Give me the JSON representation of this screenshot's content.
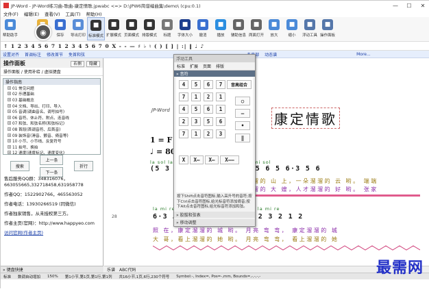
{
  "window": {
    "title": "JP-Word - JP-Word练习曲-歌曲-康定情歌.jpwabc <=> D:\\JPW6简谱编曲集\\demo\\ (cpu:0.1)",
    "controls": [
      "—",
      "☐",
      "✕"
    ]
  },
  "menu": [
    "文件(F)",
    "编辑(E)",
    "查看(V)",
    "工具(T)",
    "帮助(H)"
  ],
  "ribbon": [
    {
      "label": "帮助助手",
      "icon": "help-icon",
      "color": "#4b8ad8"
    },
    {
      "label": "打开",
      "icon": "open-folder-icon",
      "color": "#e9b23a"
    },
    {
      "label": "保存",
      "icon": "save-icon",
      "color": "#3a6fd0"
    },
    {
      "label": "导出打印",
      "icon": "export-print-icon",
      "color": "#5a8ed8"
    },
    {
      "label": "标准模式",
      "icon": "standard-mode-icon",
      "color": "#333333"
    },
    {
      "label": "扩展模式",
      "icon": "extended-mode-icon",
      "color": "#333333"
    },
    {
      "label": "页面模式",
      "icon": "page-mode-icon",
      "color": "#333333"
    },
    {
      "label": "排版模式",
      "icon": "layout-mode-icon",
      "color": "#333333"
    },
    {
      "label": "标题",
      "icon": "title-icon",
      "color": "#777777"
    },
    {
      "label": "字体大小",
      "icon": "font-size-icon",
      "color": "#1c3d8e"
    },
    {
      "label": "撤消",
      "icon": "undo-icon",
      "color": "#3a6fd0"
    },
    {
      "label": "播放",
      "icon": "play-icon",
      "color": "#2b8ee0"
    },
    {
      "label": "辅助信息",
      "icon": "assist-info-icon",
      "color": "#666666"
    },
    {
      "label": "两面打开",
      "icon": "two-page-icon",
      "color": "#666666"
    },
    {
      "label": "放大",
      "icon": "zoom-in-icon",
      "color": "#4b8ad8"
    },
    {
      "label": "缩小",
      "icon": "zoom-out-icon",
      "color": "#4b8ad8"
    },
    {
      "label": "浮动工具",
      "icon": "float-tool-icon",
      "color": "#5577aa"
    },
    {
      "label": "操作面板",
      "icon": "operation-panel-icon",
      "color": "#5577aa"
    }
  ],
  "note_toolbar": "↑ 1 2 3 4 5 6 7 1 2 3 4 5 6 7 0 X  -  -  —  ♯ ♭ ♮  ( )  [ ]  | :|  ‖  ♩ ♪",
  "link_toolbar": [
    "设置对齐",
    "首调标注",
    "修改首节",
    "免首和弦",
    "多声部",
    "动态谱",
    "More..."
  ],
  "left_panel": {
    "title": "操作面板",
    "btn_a": "右侧",
    "btn_b": "隐藏",
    "breadcrumb": "操作面板 / 使用补给 / 虚拟键盘",
    "category_head": "操作指南",
    "categories": [
      "01 常见问题",
      "02 乐理基础",
      "03 基础概念",
      "04 文档、导出、打印、导入",
      "05 音调(调曲音名、调号拍号)",
      "06 音符、休止符、附点、连音线",
      "07 和弦、和弦名称(和弦标记)",
      "08 首段(首调音符、后首音)",
      "09 装饰音(滑音、颤音、倚音等)",
      "10 小节、小节线、反复符号",
      "11 拍号、换拍",
      "12 速度(速度标记、速度变化)"
    ],
    "nav_prev": "上一条",
    "nav_next": "下一条",
    "nav_search": "搜索",
    "nav_fold": "折行",
    "info": [
      "售后服务QQ群：348316076，663055665,332718458,631958778",
      "作者QQ：1522902766，465563052",
      "作者电话：13930266519 (同微信)",
      "作者独家销售，从未授权第三方。",
      "作者主页(官网)：http://www.happyeo.com",
      "访问官网(作者主页)"
    ],
    "footer": "» 键盘快捷"
  },
  "document": {
    "app_label": "JP-Word",
    "title": "康定情歌",
    "key": "1 = F",
    "tempo": "♩ = 80",
    "bar_number": "28",
    "row1_solfege": "la sol  la  mi  re    mi sol  la  la sol   la  mi    mi sol",
    "row1_notes": "(5 3 2 …  6 5  6·3 2  3 5 6 5  6·3  5 6",
    "row1_lyric_a": "溜的 山 上，一朵溜溜的 云 哟。 端端",
    "row1_lyric_b": "溜的 大 嫂，人才溜溜的 好 哟。 张家",
    "row2_solfege": "la mi            re  sol mi  re do  la   sol mi re do la  mi re",
    "row2_notes": "6·3 … 5 3  2·1 6·  5 3  2 3 2 1  2",
    "row2_lyric_a": "照 在，康定溜溜的 城 哟。 月亮 弯 弯，  康定溜溜的 城",
    "row2_lyric_b": "大 哥，看上溜溜的 她 哟。 月亮 弯 弯，  看上溜溜的 她"
  },
  "float_panel": {
    "header": "浮动工具",
    "tabs": [
      "标准",
      "扩展",
      "页面",
      "排版"
    ],
    "section_note": "» 音符",
    "keys": [
      "4",
      "5",
      "6",
      "7",
      "7",
      "1",
      "2",
      "1",
      "4",
      "5",
      "6",
      "1",
      "2",
      "3",
      "5",
      "6",
      "7",
      "1",
      "2",
      "3"
    ],
    "group_label": "音高组合",
    "row_symbols": [
      "X",
      "X—",
      "X—",
      "X——"
    ],
    "help_text": "按下Shift点击音符图标,输入高升号的音符;按下Ctrl点击音符图标,给光标音符添加倚音;按下Alt点击音符图标,给光标音符添加和弦。",
    "section_chord": "» 胶拔和弦表",
    "section_move": "» 移动调整"
  },
  "doc_tabs": [
    "乐谱",
    "ABC代码"
  ],
  "status": [
    "标准",
    "数调自动增加",
    "150%",
    "第1小节,第1页,第1行,第1列",
    "共16小节,1页,6行,230个符号",
    "Symbol:-, Index=, Pos=-,mm, Bounds=,-,-,-,-"
  ],
  "watermark": "最需网"
}
